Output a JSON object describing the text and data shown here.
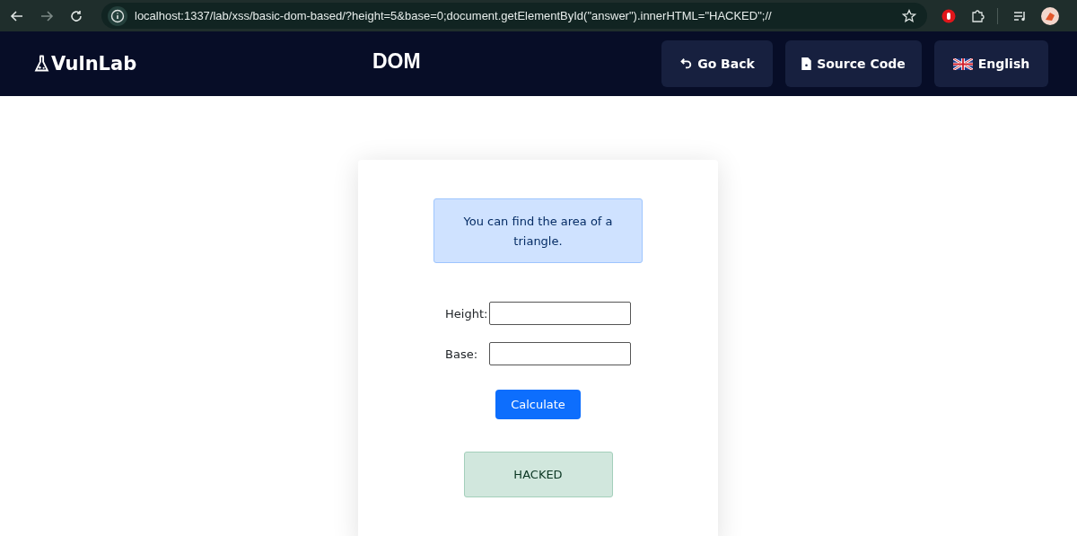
{
  "browser": {
    "url": "localhost:1337/lab/xss/basic-dom-based/?height=5&base=0;document.getElementById(\"answer\").innerHTML=\"HACKED\";//"
  },
  "header": {
    "logo": "VulnLab",
    "title": "DOM",
    "buttons": [
      {
        "kind": "back",
        "label": "Go Back"
      },
      {
        "kind": "source",
        "label": "Source Code"
      },
      {
        "kind": "language",
        "label": "English"
      }
    ]
  },
  "info": "You can find the area of a triangle.",
  "fields": [
    {
      "label": "Height:"
    },
    {
      "label": "Base:"
    }
  ],
  "calculate_button": "Calculate",
  "answer": "HACKED"
}
